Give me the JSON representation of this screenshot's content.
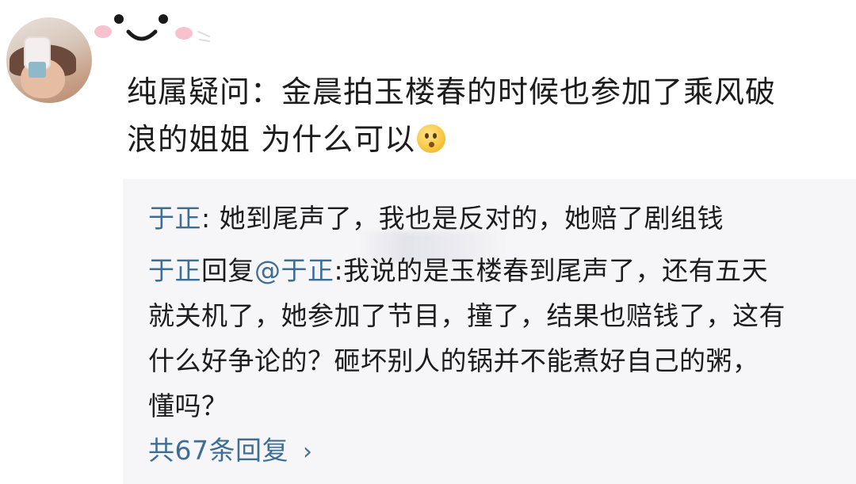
{
  "comment": {
    "line1": "纯属疑问：金晨拍玉楼春的时候也参加了乘风破",
    "line2": "浪的姐姐 为什么可以",
    "emoji": "thinking-face-emoji"
  },
  "replies": [
    {
      "user": "于正",
      "text": ": 她到尾声了，我也是反对的，她赔了剧组钱"
    },
    {
      "user": "于正",
      "action": "回复",
      "mention": "@于正",
      "line1": ":我说的是玉楼春到尾声了，还有五天",
      "line2": "就关机了，她参加了节目，撞了，结果也赔钱了，这有",
      "line3": "什么好争论的？砸坏别人的锅并不能煮好自己的粥，",
      "line4": "懂吗？"
    }
  ],
  "more_replies": {
    "label": "共67条回复",
    "chevron": "›"
  },
  "colors": {
    "link_blue": "#3f6e94",
    "reply_bg": "#f6f6f8",
    "text": "#1c1c1c"
  }
}
